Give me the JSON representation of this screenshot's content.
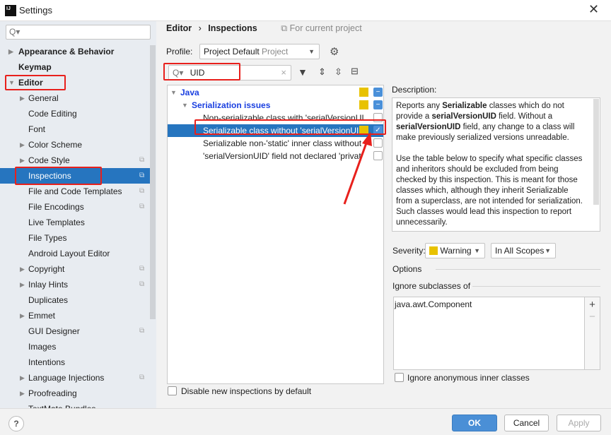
{
  "window": {
    "title": "Settings",
    "logo": "IJ",
    "close": "✕"
  },
  "sidebar": {
    "search_placeholder": "Q▾",
    "items": [
      {
        "label": "Appearance & Behavior",
        "level": 0,
        "arrow": "▶",
        "bold": true
      },
      {
        "label": "Keymap",
        "level": 0,
        "bold": true
      },
      {
        "label": "Editor",
        "level": 0,
        "arrow": "▼",
        "bold": true
      },
      {
        "label": "General",
        "level": 1,
        "arrow": "▶"
      },
      {
        "label": "Code Editing",
        "level": 1
      },
      {
        "label": "Font",
        "level": 1
      },
      {
        "label": "Color Scheme",
        "level": 1,
        "arrow": "▶"
      },
      {
        "label": "Code Style",
        "level": 1,
        "arrow": "▶",
        "copy": true
      },
      {
        "label": "Inspections",
        "level": 1,
        "copy": true,
        "selected": true
      },
      {
        "label": "File and Code Templates",
        "level": 1,
        "copy": true
      },
      {
        "label": "File Encodings",
        "level": 1,
        "copy": true
      },
      {
        "label": "Live Templates",
        "level": 1
      },
      {
        "label": "File Types",
        "level": 1
      },
      {
        "label": "Android Layout Editor",
        "level": 1
      },
      {
        "label": "Copyright",
        "level": 1,
        "arrow": "▶",
        "copy": true
      },
      {
        "label": "Inlay Hints",
        "level": 1,
        "arrow": "▶",
        "copy": true
      },
      {
        "label": "Duplicates",
        "level": 1
      },
      {
        "label": "Emmet",
        "level": 1,
        "arrow": "▶"
      },
      {
        "label": "GUI Designer",
        "level": 1,
        "copy": true
      },
      {
        "label": "Images",
        "level": 1
      },
      {
        "label": "Intentions",
        "level": 1
      },
      {
        "label": "Language Injections",
        "level": 1,
        "arrow": "▶",
        "copy": true
      },
      {
        "label": "Proofreading",
        "level": 1,
        "arrow": "▶"
      },
      {
        "label": "TextMate Bundles",
        "level": 1
      }
    ]
  },
  "breadcrumb": {
    "parent": "Editor",
    "sep": "›",
    "current": "Inspections",
    "scope": "For current project"
  },
  "profile": {
    "label": "Profile:",
    "value": "Project Default",
    "hint": "Project"
  },
  "filter": {
    "value": "UID",
    "clear": "×"
  },
  "tree": [
    {
      "label": "Java",
      "level": 0,
      "arrow": "▼",
      "style": "group",
      "severity": true,
      "check": "partial"
    },
    {
      "label": "Serialization issues",
      "level": 1,
      "arrow": "▼",
      "style": "group",
      "severity": true,
      "check": "partial"
    },
    {
      "label": "Non-serializable class with 'serialVersionUI",
      "level": 2,
      "check": "off"
    },
    {
      "label": "Serializable class without 'serialVersionUID",
      "level": 2,
      "check": "on",
      "severity": true,
      "selected": true
    },
    {
      "label": "Serializable non-'static' inner class without",
      "level": 2,
      "check": "off"
    },
    {
      "label": "'serialVersionUID' field not declared 'privat",
      "level": 2,
      "check": "off"
    }
  ],
  "disable_new": "Disable new inspections by default",
  "description": {
    "label": "Description:",
    "p1": [
      "Reports any ",
      "Serializable",
      " classes which do not provide a ",
      "serialVersionUID",
      " field. Without a ",
      "serialVersionUID",
      " field, any change to a class will make previously serialized versions unreadable."
    ],
    "p2": "Use the table below to specify what specific classes and inheritors should be excluded from being checked by this inspection. This is meant for those classes which, although they inherit Serializable from a superclass, are not intended for serialization. Such classes would lead this inspection to report unnecessarily."
  },
  "severity": {
    "label": "Severity:",
    "value": "Warning",
    "color": "#e8c200",
    "scope": "In All Scopes"
  },
  "options": {
    "label": "Options",
    "ignore_label": "Ignore subclasses of",
    "list": [
      "java.awt.Component"
    ],
    "add": "+",
    "remove": "−",
    "anon": "Ignore anonymous inner classes"
  },
  "footer": {
    "help": "?",
    "ok": "OK",
    "cancel": "Cancel",
    "apply": "Apply"
  },
  "colors": {
    "accent": "#2675bf",
    "annotation": "#e8201c"
  }
}
